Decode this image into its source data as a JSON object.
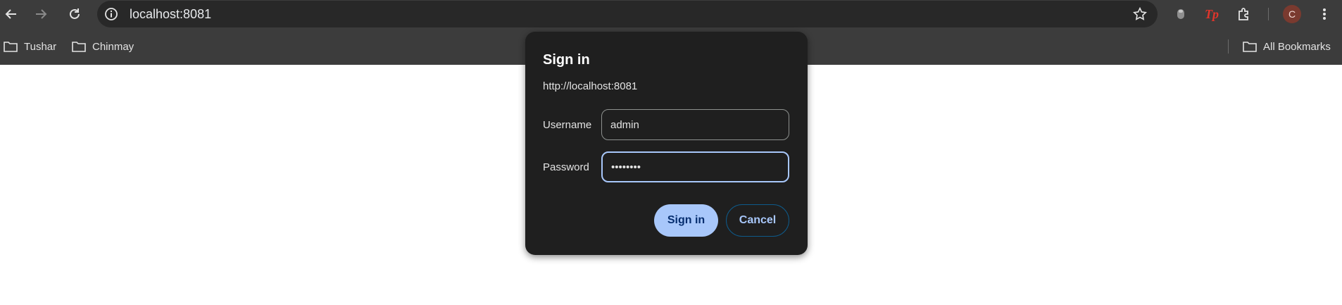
{
  "browser": {
    "url": "localhost:8081",
    "avatar_initial": "C",
    "extension_tp_label": "Tp"
  },
  "bookmarks": {
    "items": [
      {
        "label": "Tushar"
      },
      {
        "label": "Chinmay"
      }
    ],
    "all_bookmarks_label": "All Bookmarks"
  },
  "dialog": {
    "title": "Sign in",
    "origin": "http://localhost:8081",
    "username_label": "Username",
    "username_value": "admin",
    "password_label": "Password",
    "password_value_masked": "••••••••",
    "signin_label": "Sign in",
    "cancel_label": "Cancel"
  },
  "colors": {
    "chrome_bg": "#3c3c3c",
    "omnibox_bg": "#282828",
    "dialog_bg": "#1f1f1f",
    "primary_button": "#a8c7fa",
    "focus_ring": "#a8c7fa",
    "extension_red": "#e0352b"
  }
}
